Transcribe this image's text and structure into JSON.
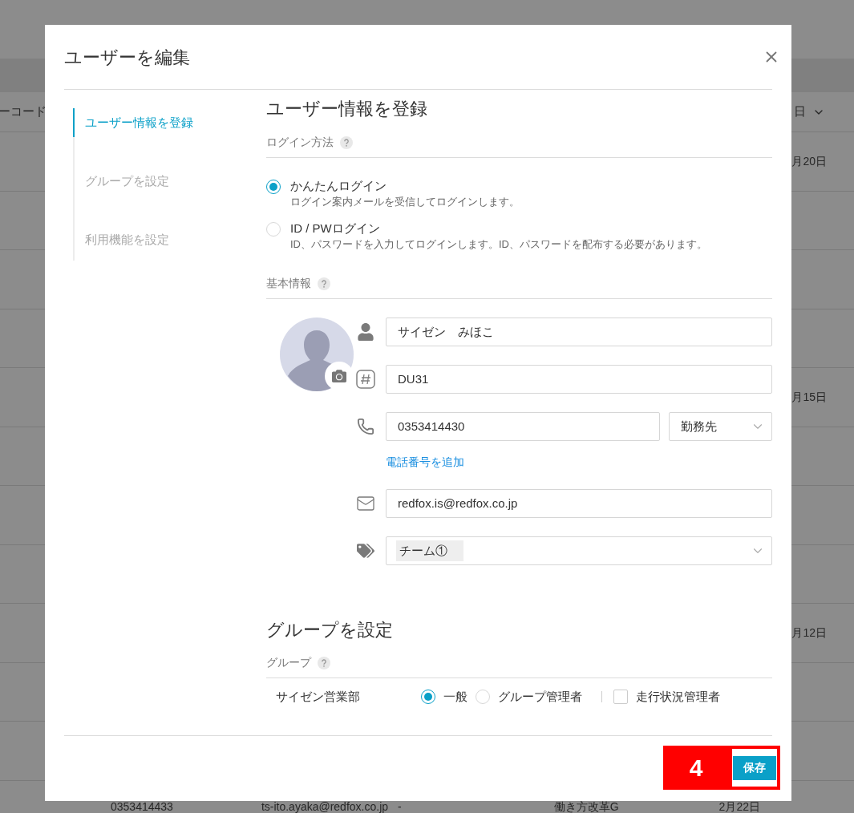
{
  "background": {
    "header_left": "ーコード",
    "header_right": "日",
    "rows": [
      {
        "date": "月20日"
      },
      {},
      {},
      {},
      {
        "date": "月15日"
      },
      {},
      {},
      {},
      {
        "date": "月12日"
      },
      {},
      {}
    ],
    "last_row": [
      "0353414433",
      "ts-ito.ayaka@redfox.co.jp",
      "-",
      "働き方改革G",
      "2月22日"
    ]
  },
  "dialog": {
    "title": "ユーザーを編集",
    "nav": [
      {
        "label": "ユーザー情報を登録",
        "selected": true
      },
      {
        "label": "グループを設定",
        "selected": false
      },
      {
        "label": "利用機能を設定",
        "selected": false
      }
    ],
    "user_section": {
      "heading": "ユーザー情報を登録",
      "login_label": "ログイン方法",
      "login_options": [
        {
          "label": "かんたんログイン",
          "description": "ログイン案内メールを受信してログインします。",
          "selected": true
        },
        {
          "label": "ID / PWログイン",
          "description": "ID、パスワードを入力してログインします。ID、パスワードを配布する必要があります。",
          "selected": false
        }
      ],
      "basic_label": "基本情報",
      "fields": [
        {
          "kind": "name",
          "value": "サイゼン　みほこ"
        },
        {
          "kind": "code",
          "value": "DU31"
        },
        {
          "kind": "phone",
          "value": "0353414430",
          "type_select": "勤務先",
          "add_link": "電話番号を追加"
        },
        {
          "kind": "email",
          "value": "redfox.is@redfox.co.jp"
        },
        {
          "kind": "tags",
          "chips": [
            "チーム①"
          ]
        }
      ]
    },
    "group_section": {
      "heading": "グループを設定",
      "group_label": "グループ",
      "groups": [
        {
          "name": "サイゼン営業部",
          "roles": [
            {
              "label": "一般",
              "selected": true
            },
            {
              "label": "グループ管理者",
              "selected": false
            }
          ],
          "monitor": {
            "label": "走行状況管理者",
            "checked": false
          }
        }
      ]
    },
    "save_button": "保存",
    "annotation": "4"
  }
}
